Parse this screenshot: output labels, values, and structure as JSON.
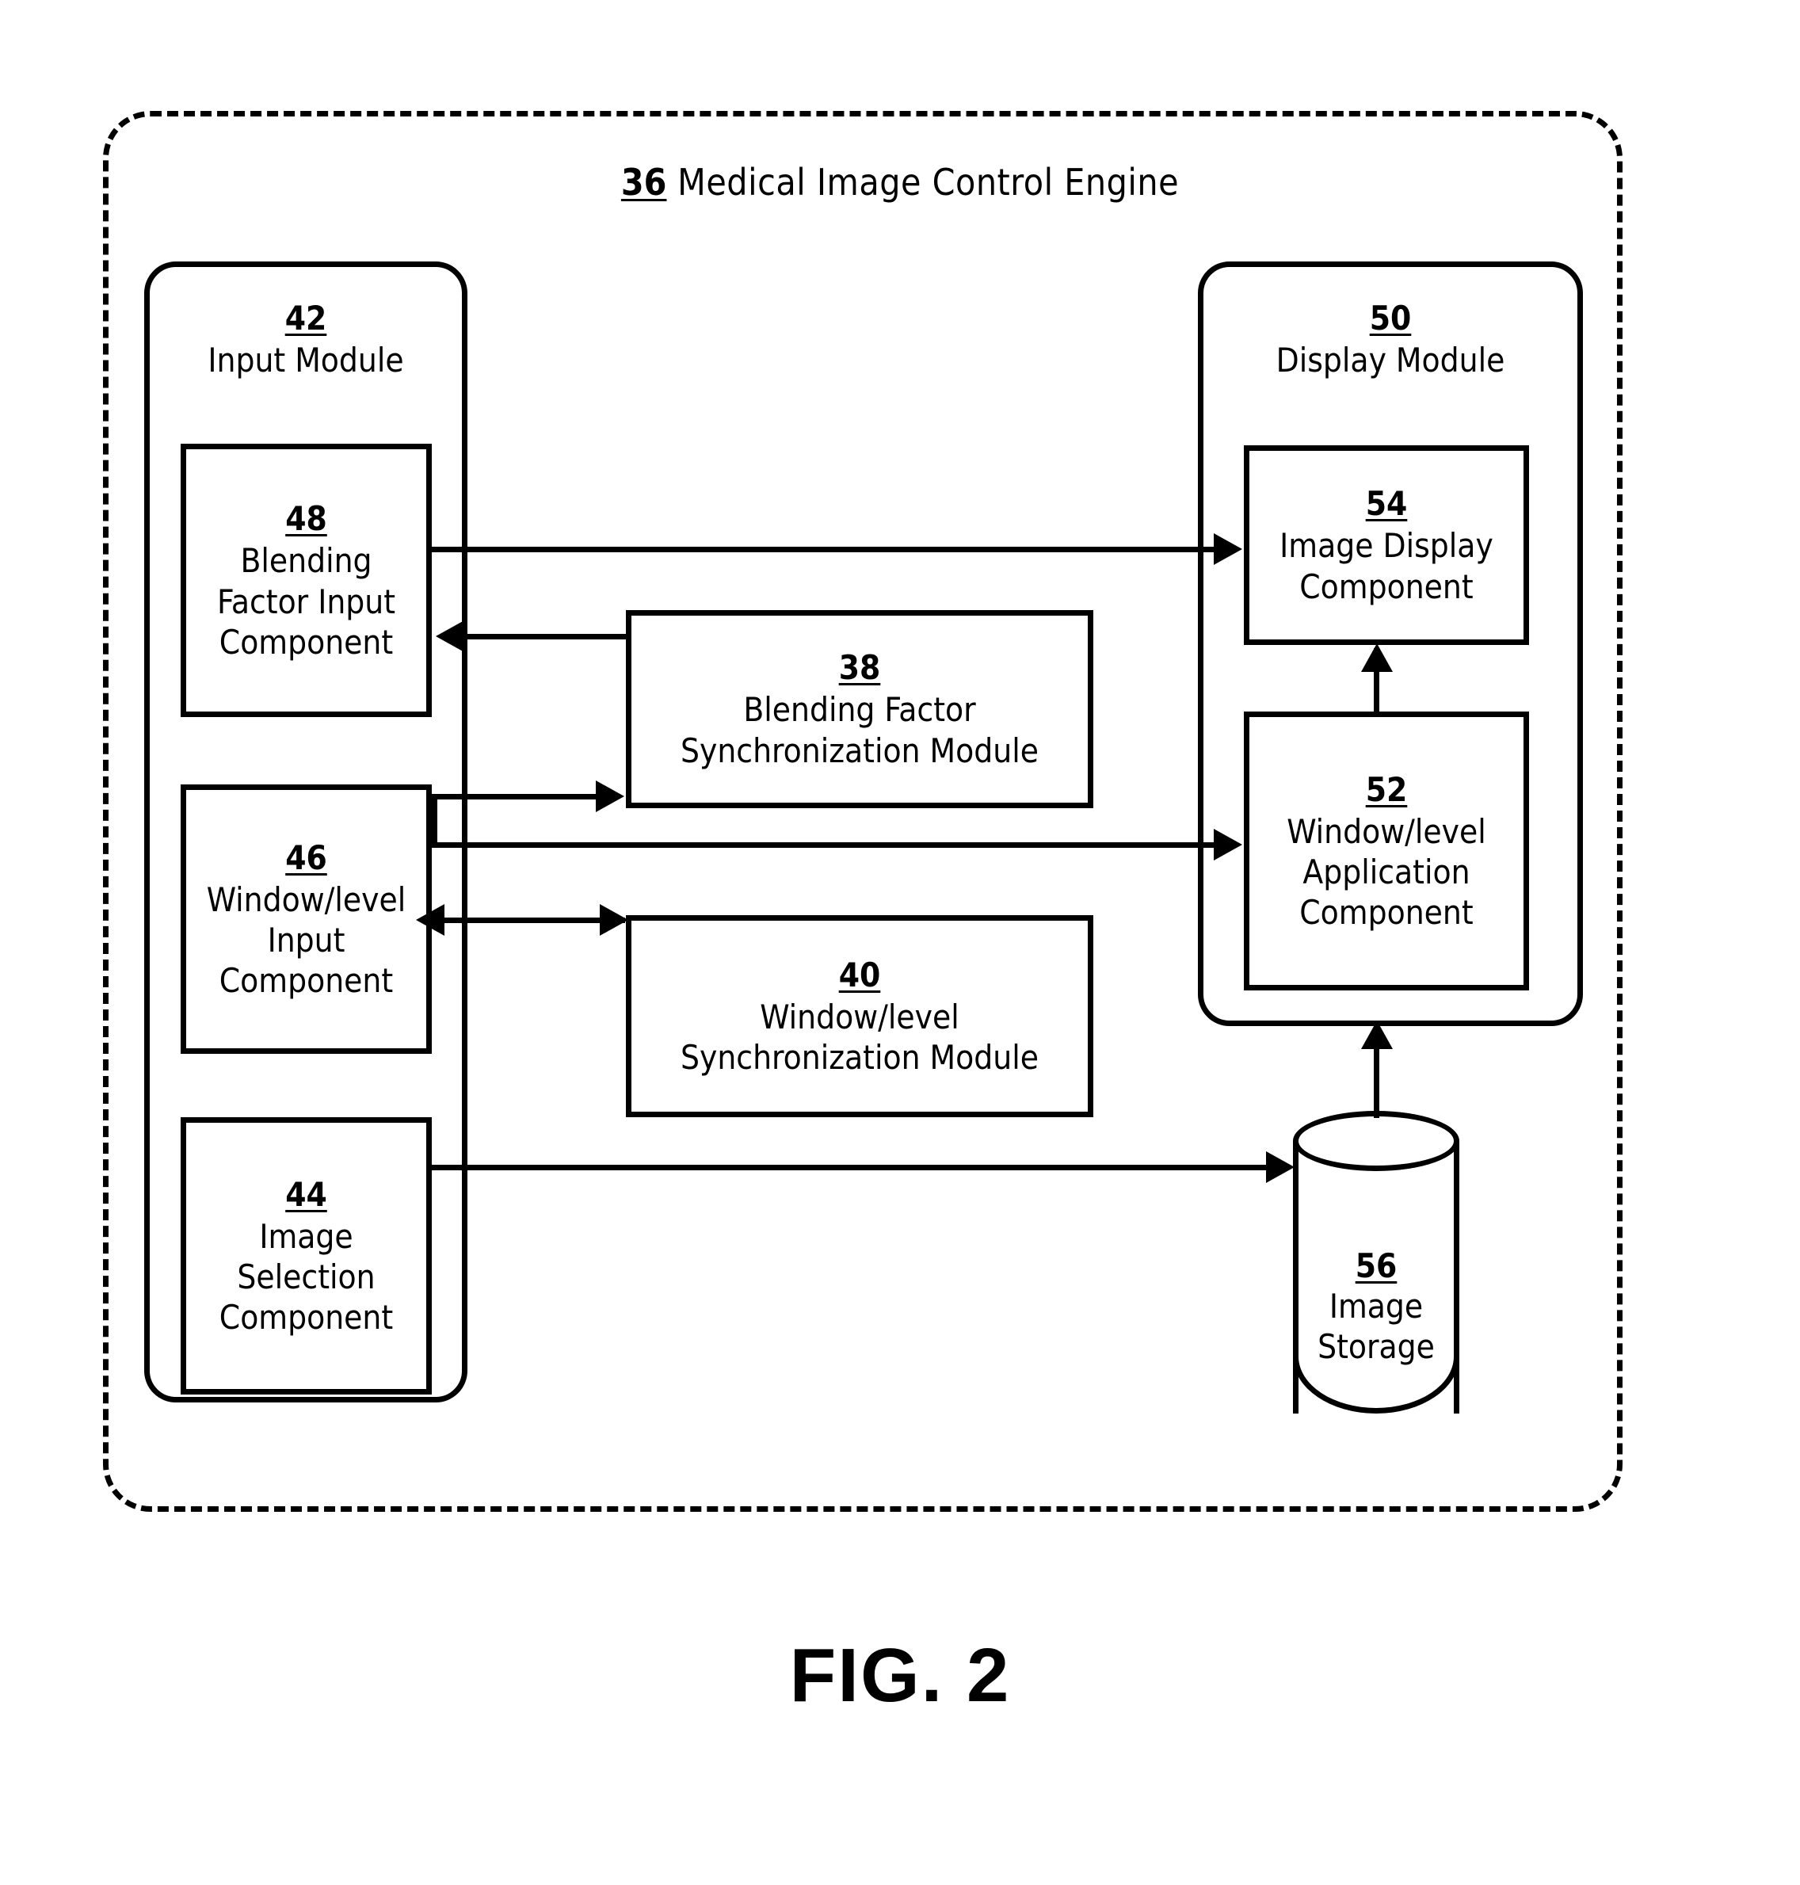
{
  "figure": {
    "caption": "FIG. 2",
    "engine": {
      "ref": "36",
      "title": "Medical Image Control Engine"
    }
  },
  "modules": {
    "input_module": {
      "ref": "42",
      "label": "Input Module"
    },
    "display_module": {
      "ref": "50",
      "label": "Display Module"
    }
  },
  "components": {
    "blending_factor_input": {
      "ref": "48",
      "label": "Blending\nFactor Input\nComponent"
    },
    "window_level_input": {
      "ref": "46",
      "label": "Window/level\nInput\nComponent"
    },
    "image_selection": {
      "ref": "44",
      "label": "Image\nSelection\nComponent"
    },
    "blending_factor_sync": {
      "ref": "38",
      "label": "Blending Factor\nSynchronization Module"
    },
    "window_level_sync": {
      "ref": "40",
      "label": "Window/level\nSynchronization Module"
    },
    "image_display": {
      "ref": "54",
      "label": "Image Display\nComponent"
    },
    "window_level_application": {
      "ref": "52",
      "label": "Window/level\nApplication\nComponent"
    },
    "image_storage": {
      "ref": "56",
      "label": "Image\nStorage"
    }
  },
  "connections": [
    {
      "name": "blending-input-to-image-display",
      "from": "48",
      "to": "54",
      "direction": "one-way"
    },
    {
      "name": "blending-sync-to-blending-input",
      "from": "38",
      "to": "48",
      "direction": "one-way"
    },
    {
      "name": "window-level-input-to-blending-sync",
      "from": "46",
      "to": "38",
      "direction": "one-way"
    },
    {
      "name": "window-level-input-to-window-level-application",
      "from": "46",
      "to": "52",
      "direction": "one-way"
    },
    {
      "name": "window-level-input-to-window-level-sync",
      "from": "46",
      "to": "40",
      "direction": "two-way"
    },
    {
      "name": "image-selection-to-image-storage",
      "from": "44",
      "to": "56",
      "direction": "one-way"
    },
    {
      "name": "image-storage-to-window-level-application",
      "from": "56",
      "to": "52",
      "direction": "one-way"
    },
    {
      "name": "window-level-application-to-image-display",
      "from": "52",
      "to": "54",
      "direction": "one-way"
    }
  ],
  "colors": {
    "stroke": "#000000",
    "background": "#ffffff"
  }
}
